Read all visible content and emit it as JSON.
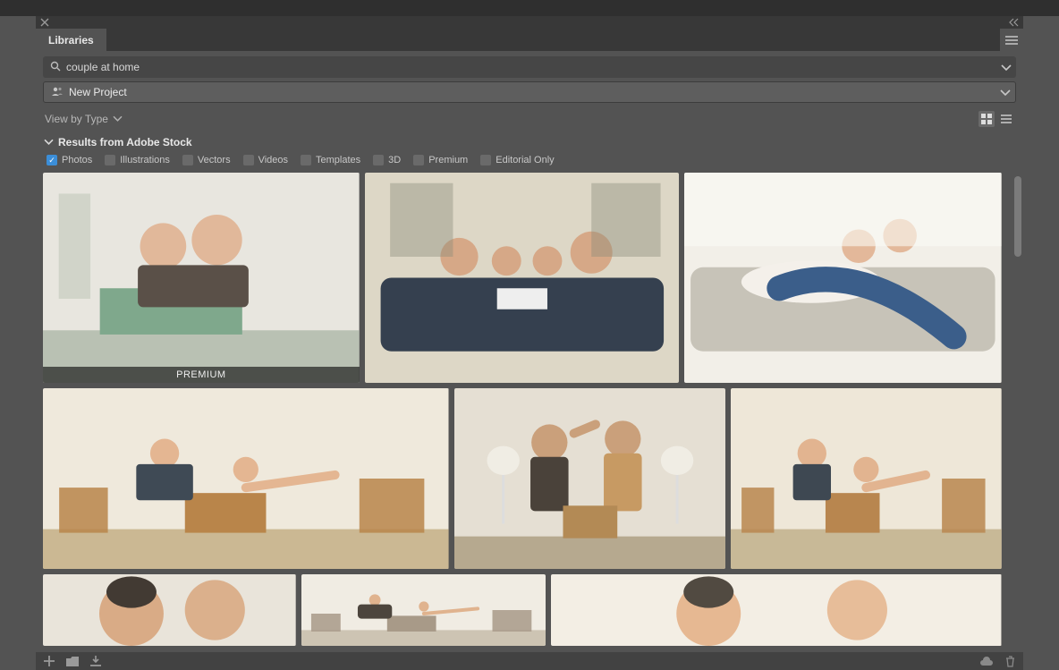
{
  "tab_label": "Libraries",
  "search": {
    "query": "couple at home"
  },
  "project": {
    "name": "New Project"
  },
  "view_by_label": "View by Type",
  "results_header": "Results from Adobe Stock",
  "filters": [
    {
      "key": "photos",
      "label": "Photos",
      "checked": true
    },
    {
      "key": "illustrations",
      "label": "Illustrations",
      "checked": false
    },
    {
      "key": "vectors",
      "label": "Vectors",
      "checked": false
    },
    {
      "key": "videos",
      "label": "Videos",
      "checked": false
    },
    {
      "key": "templates",
      "label": "Templates",
      "checked": false
    },
    {
      "key": "3d",
      "label": "3D",
      "checked": false
    },
    {
      "key": "premium",
      "label": "Premium",
      "checked": false
    },
    {
      "key": "editorial",
      "label": "Editorial Only",
      "checked": false
    }
  ],
  "badge_premium": "PREMIUM",
  "rows": [
    {
      "heights": 235,
      "widths": [
        354,
        352,
        355
      ],
      "premium_index": 0
    },
    {
      "heights": 202,
      "widths": [
        454,
        304,
        303
      ]
    },
    {
      "heights": 80,
      "widths": [
        283,
        274,
        504
      ]
    }
  ]
}
